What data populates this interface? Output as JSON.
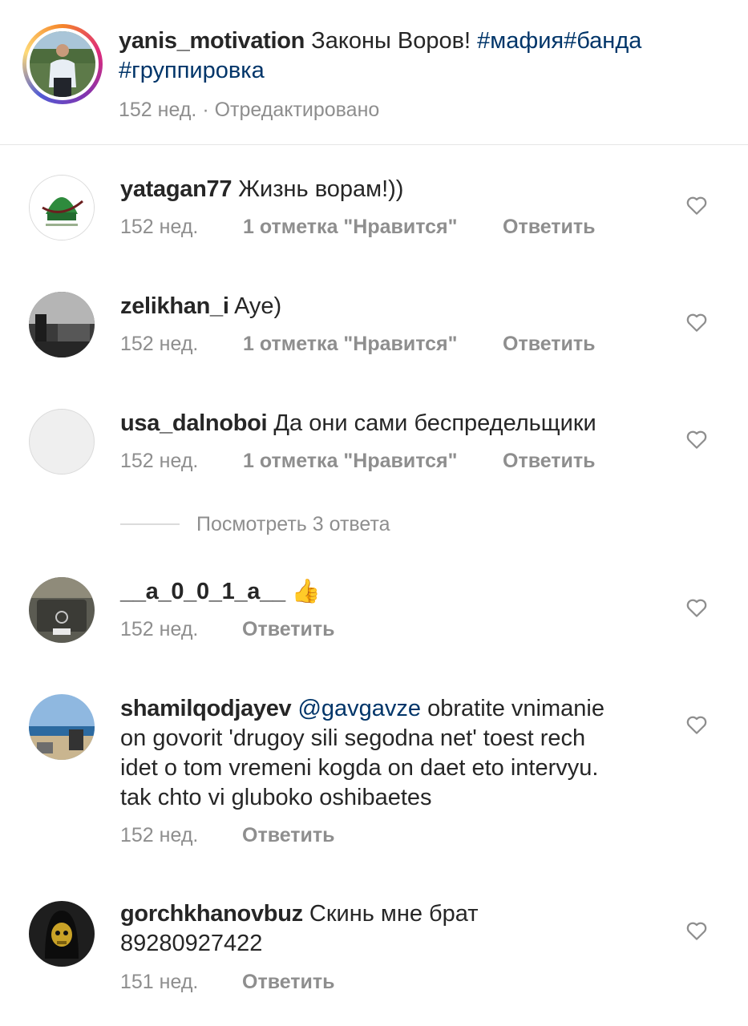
{
  "post": {
    "username": "yanis_motivation",
    "caption_text": "Законы Воров!",
    "hashtags": [
      "#мафия",
      "#банда",
      "#группировка"
    ],
    "time": "152 нед.",
    "separator": "·",
    "edited": "Отредактировано"
  },
  "comments": [
    {
      "username": "yatagan77",
      "text": "Жизнь ворам!))",
      "time": "152 нед.",
      "likes": "1 отметка \"Нравится\"",
      "reply": "Ответить"
    },
    {
      "username": "zelikhan_i",
      "text": "Aye)",
      "time": "152 нед.",
      "likes": "1 отметка \"Нравится\"",
      "reply": "Ответить"
    },
    {
      "username": "usa_dalnoboi",
      "text": "Да они сами беспредельщики",
      "time": "152 нед.",
      "likes": "1 отметка \"Нравится\"",
      "reply": "Ответить"
    },
    {
      "username": "__a_0_0_1_a__",
      "text": "👍",
      "time": "152 нед.",
      "reply": "Ответить"
    },
    {
      "username": "shamilqodjayev",
      "mention": "@gavgavze",
      "text_lines": [
        "obratite vnimanie",
        "on govorit 'drugoy sili segodna net' toest rech",
        "idet o tom vremeni kogda on daet eto intervyu.",
        "tak chto vi gluboko oshibaetes"
      ],
      "time": "152 нед.",
      "reply": "Ответить"
    },
    {
      "username": "gorchkhanovbuz",
      "text": "Скинь мне брат",
      "text_line2": "89280927422",
      "time": "151 нед.",
      "reply": "Ответить"
    }
  ],
  "view_replies": "Посмотреть 3 ответа",
  "icons": {
    "like": "heart-outline-icon"
  },
  "colors": {
    "hashtag": "#003569",
    "meta": "#8e8e8e",
    "text": "#262626"
  }
}
